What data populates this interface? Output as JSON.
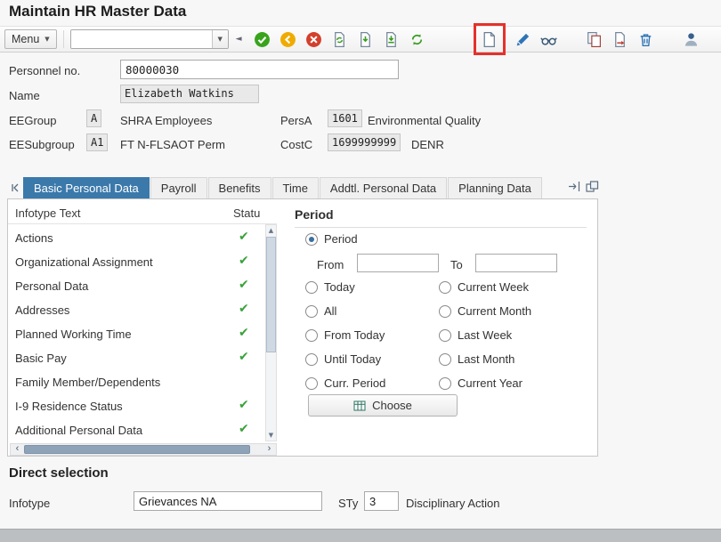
{
  "title": "Maintain HR Master Data",
  "colors": {
    "active_tab": "#3b79ab",
    "check_green": "#3aa13a",
    "highlight_red": "#e5312b",
    "toolbar_enter_green": "#38a41c",
    "toolbar_back_yellow": "#f0ab00",
    "toolbar_cancel_red": "#d43f2c"
  },
  "glyphs": {
    "caret_down": "▼",
    "collapse_left": "◄",
    "scroll_up": "▲",
    "scroll_down": "▼",
    "scroll_left": "‹",
    "scroll_right": "›"
  },
  "toolbar": {
    "menu_label": "Menu",
    "command_value": "",
    "icons": [
      "enter-icon",
      "back-icon",
      "cancel-icon",
      "print-icon",
      "import-icon",
      "export-icon",
      "refresh-icon",
      "create-icon",
      "change-icon",
      "display-icon",
      "copy-icon",
      "delimit-icon",
      "delete-icon",
      "person-icon"
    ],
    "highlighted_icon": "create-icon"
  },
  "fields": {
    "personnel_label": "Personnel no.",
    "personnel_value": "80000030",
    "name_label": "Name",
    "name_value": "Elizabeth Watkins",
    "eegroup_label": "EEGroup",
    "eegroup_code": "A",
    "eegroup_text": "SHRA Employees",
    "persa_label": "PersA",
    "persa_code": "1601",
    "persa_text": "Environmental Quality",
    "eesubgroup_label": "EESubgroup",
    "eesubgroup_code": "A1",
    "eesubgroup_text": "FT N-FLSAOT Perm",
    "costc_label": "CostC",
    "costc_code": "1699999999",
    "costc_text": "DENR"
  },
  "tabs": [
    "Basic Personal Data",
    "Payroll",
    "Benefits",
    "Time",
    "Addtl. Personal Data",
    "Planning Data"
  ],
  "active_tab_index": 0,
  "infotype_table": {
    "header_text": "Infotype Text",
    "header_status": "Statu",
    "rows": [
      {
        "text": "Actions",
        "status": "✔"
      },
      {
        "text": "Organizational Assignment",
        "status": "✔"
      },
      {
        "text": "Personal Data",
        "status": "✔"
      },
      {
        "text": "Addresses",
        "status": "✔"
      },
      {
        "text": "Planned Working Time",
        "status": "✔"
      },
      {
        "text": "Basic Pay",
        "status": "✔"
      },
      {
        "text": "Family Member/Dependents",
        "status": ""
      },
      {
        "text": "I-9 Residence Status",
        "status": "✔"
      },
      {
        "text": "Additional Personal Data",
        "status": "✔"
      }
    ]
  },
  "period": {
    "heading": "Period",
    "radio_period": "Period",
    "from_label": "From",
    "to_label": "To",
    "from_value": "",
    "to_value": "",
    "left_options": [
      "Today",
      "All",
      "From Today",
      "Until Today",
      "Curr. Period"
    ],
    "right_options": [
      "Current Week",
      "Current Month",
      "Last Week",
      "Last Month",
      "Current Year"
    ],
    "choose_label": "Choose"
  },
  "direct_selection": {
    "heading": "Direct selection",
    "infotype_label": "Infotype",
    "infotype_value": "Grievances NA",
    "sty_label": "STy",
    "sty_value": "3",
    "sty_text": "Disciplinary Action"
  }
}
